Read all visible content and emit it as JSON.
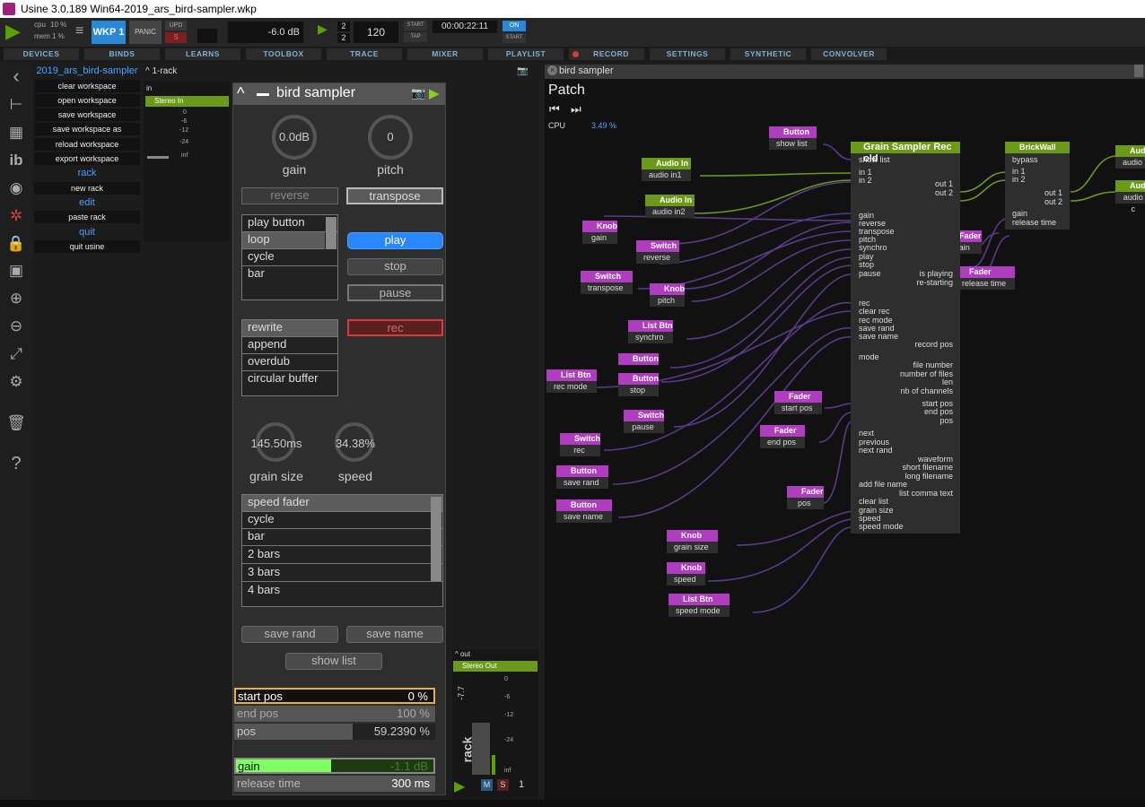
{
  "window": {
    "title": "Usine 3.0.189 Win64-2019_ars_bird-sampler.wkp"
  },
  "topbar": {
    "cpu_label": "cpu",
    "cpu_value": "10 %",
    "mem_label": "mem",
    "mem_value": "1 %",
    "wkp": "WKP 1",
    "panic": "PANIC",
    "upd": "UPD",
    "s": "S",
    "master_db": "-6.0 dB",
    "sig_num": "2",
    "sig_den": "2",
    "bpm": "120",
    "start": "START",
    "tap": "TAP",
    "time": "00:00:22:11",
    "on": "ON",
    "start2": "START"
  },
  "menubar": [
    "DEVICES",
    "BINDS",
    "LEARNS",
    "TOOLBOX",
    "TRACE",
    "MIXER",
    "PLAYLIST",
    "RECORD",
    "SETTINGS",
    "SYNTHETIC",
    "CONVOLVER"
  ],
  "colors": {
    "accent": "#49a3ff",
    "pink": "#b03cc0",
    "green": "#6b9a18",
    "rec": "#d83a3a"
  },
  "workspace": {
    "title": "2019_ars_bird-sampler",
    "items": [
      "clear workspace",
      "open workspace",
      "save workspace",
      "save workspace as",
      "reload workspace",
      "export workspace"
    ],
    "rack": "rack",
    "rack_items": [
      "new rack"
    ],
    "edit": "edit",
    "edit_items": [
      "paste rack"
    ],
    "quit": "quit",
    "quit_items": [
      "quit usine"
    ]
  },
  "rack": {
    "name": "1-rack",
    "in": "in",
    "stereo_in": "Stereo In",
    "scale": [
      "0",
      "-6",
      "-12",
      "-24",
      "inf"
    ]
  },
  "bird": {
    "title": "bird sampler",
    "gain_value": "0.0dB",
    "gain_label": "gain",
    "pitch_value": "0",
    "pitch_label": "pitch",
    "reverse": "reverse",
    "transpose": "transpose",
    "modes": [
      "play button",
      "loop",
      "cycle",
      "bar"
    ],
    "play": "play",
    "stop": "stop",
    "pause": "pause",
    "rec_modes": [
      "rewrite",
      "append",
      "overdub",
      "circular buffer"
    ],
    "rec": "rec",
    "grain_value": "145.50ms",
    "grain_label": "grain size",
    "speed_value": "34.38%",
    "speed_label": "speed",
    "speed_modes": [
      "speed fader",
      "cycle",
      "bar",
      "2 bars",
      "3 bars",
      "4 bars"
    ],
    "save_rand": "save rand",
    "save_name": "save name",
    "show_list": "show list",
    "start_pos_label": "start pos",
    "start_pos_value": "0 %",
    "end_pos_label": "end pos",
    "end_pos_value": "100 %",
    "pos_label": "pos",
    "pos_value": "59.2390 %",
    "gain2_label": "gain",
    "gain2_value": "-1.1 dB",
    "release_label": "release time",
    "release_value": "300 ms",
    "pos_fill": 0.59,
    "gain_fill": 0.48
  },
  "outrack": {
    "out": "out",
    "stereo_out": "Stereo Out",
    "db": "-7.7",
    "scale": [
      "0",
      "-6",
      "-12",
      "-24",
      "inf"
    ],
    "rack": "rack",
    "m": "M",
    "s": "S",
    "num": "1"
  },
  "patch": {
    "title": "bird sampler",
    "heading": "Patch",
    "cpu_label": "CPU",
    "cpu_value": "3.49 %",
    "modules": [
      {
        "h": "Button",
        "b": "show list",
        "c": "pink"
      },
      {
        "h": "Audio In",
        "b": "audio in1",
        "c": "green"
      },
      {
        "h": "Audio In",
        "b": "audio in2",
        "c": "green"
      },
      {
        "h": "Knob",
        "b": "gain",
        "c": "pink"
      },
      {
        "h": "Switch",
        "b": "reverse",
        "c": "pink"
      },
      {
        "h": "Switch",
        "b": "transpose",
        "c": "pink"
      },
      {
        "h": "Knob",
        "b": "pitch",
        "c": "pink"
      },
      {
        "h": "List Btn",
        "b": "synchro",
        "c": "pink"
      },
      {
        "h": "List Btn",
        "b": "rec mode",
        "c": "pink"
      },
      {
        "h": "Button",
        "b": "",
        "c": "pink"
      },
      {
        "h": "Button",
        "b": "stop",
        "c": "pink"
      },
      {
        "h": "Switch",
        "b": "pause",
        "c": "pink"
      },
      {
        "h": "Switch",
        "b": "rec",
        "c": "pink"
      },
      {
        "h": "Button",
        "b": "save rand",
        "c": "pink"
      },
      {
        "h": "Button",
        "b": "save name",
        "c": "pink"
      },
      {
        "h": "Knob",
        "b": "grain size",
        "c": "pink"
      },
      {
        "h": "Knob",
        "b": "speed",
        "c": "pink"
      },
      {
        "h": "List Btn",
        "b": "speed mode",
        "c": "pink"
      },
      {
        "h": "Fader",
        "b": "start pos",
        "c": "pink"
      },
      {
        "h": "Fader",
        "b": "end pos",
        "c": "pink"
      },
      {
        "h": "Fader",
        "b": "pos",
        "c": "pink"
      },
      {
        "h": "Fader",
        "b": "gain",
        "c": "pink"
      },
      {
        "h": "Fader",
        "b": "release time",
        "c": "pink"
      },
      {
        "h": "BrickWall",
        "b": "",
        "c": "green"
      },
      {
        "h": "Aud",
        "b": "audio",
        "c": "green"
      },
      {
        "h": "Audio",
        "b": "audio c",
        "c": "green"
      }
    ],
    "brick_pins": [
      "bypass",
      "in 1",
      "in 2",
      "out 1",
      "out 2",
      "gain",
      "release time"
    ],
    "grain_title": "Grain Sampler Rec old",
    "grain_pins_left": [
      "show list",
      "in 1",
      "in 2",
      "gain",
      "reverse",
      "transpose",
      "pitch",
      "synchro",
      "play",
      "stop",
      "pause",
      "rec",
      "clear rec",
      "rec mode",
      "save rand",
      "save name",
      "record pos",
      "mode",
      "file number",
      "number of files",
      "len",
      "nb of channels",
      "start pos",
      "end pos",
      "pos",
      "next",
      "previous",
      "next rand",
      "waveform",
      "short filename",
      "long filename",
      "add file name",
      "list comma text",
      "clear list",
      "grain size",
      "speed",
      "speed mode"
    ],
    "grain_pins_right": [
      "out 1",
      "out 2",
      "is playing",
      "re-starting"
    ]
  }
}
